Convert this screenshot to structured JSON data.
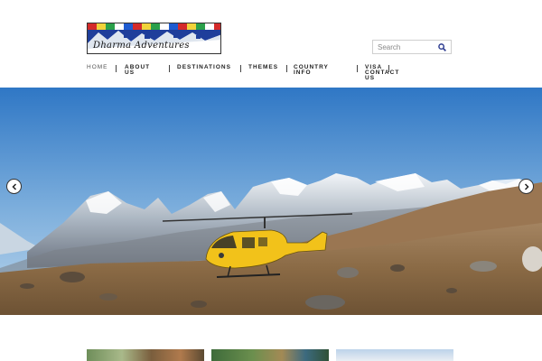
{
  "header": {
    "logo_text": "Dharma Adventures",
    "search_placeholder": "Search"
  },
  "nav": {
    "items": [
      {
        "label": "Home",
        "active": true
      },
      {
        "label": "About Us"
      },
      {
        "label": "Destinations"
      },
      {
        "label": "Themes"
      },
      {
        "label": "Country Info"
      },
      {
        "label": "Visa"
      },
      {
        "label": "Contact Us"
      }
    ]
  },
  "slider": {
    "prev_icon": "chevron-left-icon",
    "next_icon": "chevron-right-icon"
  },
  "colors": {
    "sky_top": "#2f77c5",
    "sky_bottom": "#bcd6ec",
    "helicopter": "#f2c21a",
    "ground": "#8a6a45"
  }
}
